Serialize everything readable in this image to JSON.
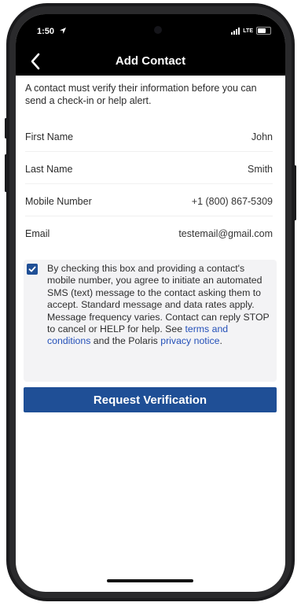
{
  "status_bar": {
    "time": "1:50",
    "network": "LTE"
  },
  "nav": {
    "title": "Add Contact",
    "back_icon": "chevron-left-icon"
  },
  "intro_text": "A contact must verify their information before you can send a check-in or help alert.",
  "fields": [
    {
      "label": "First Name",
      "value": "John"
    },
    {
      "label": "Last Name",
      "value": "Smith"
    },
    {
      "label": "Mobile Number",
      "value": "+1 (800) 867-5309"
    },
    {
      "label": "Email",
      "value": "testemail@gmail.com"
    }
  ],
  "consent": {
    "checked": true,
    "text_before": "By checking this box and providing a contact's mobile number, you agree to initiate an automated SMS (text) message to the contact asking them to accept. Standard message and data rates apply. Message frequency varies. Contact can reply STOP to cancel or HELP for help. See ",
    "terms_link": "terms and conditions",
    "text_middle": " and the Polaris ",
    "privacy_link": "privacy notice",
    "text_end": "."
  },
  "request_button": {
    "label": "Request Verification"
  },
  "colors": {
    "accent": "#1f4f96",
    "link": "#2450b8",
    "nav_background": "#000000"
  }
}
